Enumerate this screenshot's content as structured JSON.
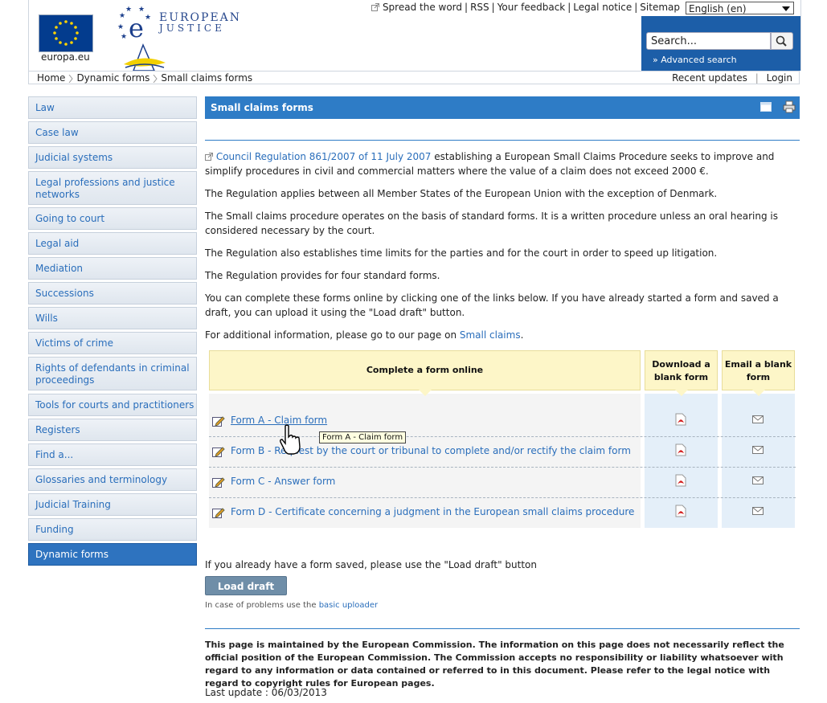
{
  "header": {
    "europa_label": "europa.eu",
    "logo_line1": "EUROPEAN",
    "logo_line2": "JUSTICE",
    "top_links": [
      "Spread the word",
      "RSS",
      "Your feedback",
      "Legal notice",
      "Sitemap"
    ],
    "language": "English (en)",
    "search_placeholder": "Search...",
    "advanced_search": "» Advanced search"
  },
  "breadcrumb": {
    "items": [
      "Home",
      "Dynamic forms",
      "Small claims forms"
    ],
    "recent_updates": "Recent updates",
    "login": "Login"
  },
  "sidebar": {
    "items": [
      {
        "label": "Law"
      },
      {
        "label": "Case law"
      },
      {
        "label": "Judicial systems"
      },
      {
        "label": "Legal professions and justice networks"
      },
      {
        "label": "Going to court"
      },
      {
        "label": "Legal aid"
      },
      {
        "label": "Mediation"
      },
      {
        "label": "Successions"
      },
      {
        "label": "Wills"
      },
      {
        "label": "Victims of crime"
      },
      {
        "label": "Rights of defendants in criminal proceedings"
      },
      {
        "label": "Tools for courts and practitioners"
      },
      {
        "label": "Registers"
      },
      {
        "label": "Find a..."
      },
      {
        "label": "Glossaries and terminology"
      },
      {
        "label": "Judicial Training"
      },
      {
        "label": "Funding"
      },
      {
        "label": "Dynamic forms"
      }
    ],
    "active": "Dynamic forms"
  },
  "main": {
    "title": "Small claims forms",
    "intro_link": "Council Regulation 861/2007 of 11 July 2007",
    "intro_rest": " establishing a European Small Claims Procedure seeks to improve and simplify procedures in civil and commercial matters where the value of a claim does not exceed 2000 €.",
    "p2": "The Regulation applies between all Member States of the European Union with the exception of Denmark.",
    "p3": "The Small claims procedure operates on the basis of standard forms. It is a written procedure unless an oral hearing is considered necessary by the court.",
    "p4": "The Regulation also establishes time limits for the parties and for the court in order to speed up litigation.",
    "p5": "The Regulation provides for four standard forms.",
    "p6": "You can complete these forms online by clicking one of the links below. If you have already started a form and saved a draft, you can upload it using the \"Load draft\" button.",
    "p7_prefix": "For additional information, please go to our page on ",
    "p7_link": "Small claims",
    "p7_suffix": "."
  },
  "forms_table": {
    "col_online": "Complete a form online",
    "col_download": "Download a blank form",
    "col_email": "Email a blank form",
    "rows": [
      {
        "label": "Form A - Claim form"
      },
      {
        "label": "Form B - Request by the court or tribunal to complete and/or rectify the claim form"
      },
      {
        "label": "Form C - Answer form"
      },
      {
        "label": "Form D - Certificate concerning a judgment in the European small claims procedure"
      }
    ],
    "tooltip": "Form A - Claim form"
  },
  "draft": {
    "prompt": "If you already have a form saved, please use the \"Load draft\" button",
    "button": "Load draft",
    "problem_prefix": "In case of problems use the ",
    "problem_link": "basic uploader"
  },
  "footer": {
    "disclaimer": "This page is maintained by the European Commission. The information on this page does not necessarily reflect the official position of the European Commission. The Commission accepts no responsibility or liability whatsoever with regard to any information or data contained or referred to in this document. Please refer to the legal notice with regard to copyright rules for European pages.",
    "last_update": "Last update : 06/03/2013"
  },
  "colors": {
    "brand_blue": "#2e7cc6",
    "link": "#2a6ebb",
    "highlight_yellow": "#fdf6c8"
  }
}
